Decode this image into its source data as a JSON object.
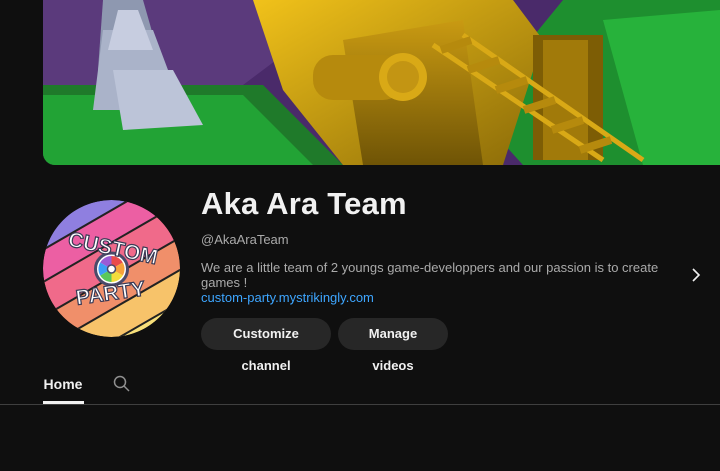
{
  "channel": {
    "name": "Aka Ara Team",
    "handle": "@AkaAraTeam",
    "description": "We are a little team of 2 youngs game-developpers and our passion is to create games !",
    "link": "custom-party.mystrikingly.com",
    "avatar_text_top": "CUSTOM",
    "avatar_text_bottom": "PARTY"
  },
  "actions": {
    "customize_label": "Customize channel",
    "manage_label": "Manage videos"
  },
  "tabs": [
    {
      "label": "Home",
      "selected": true
    }
  ],
  "icons": {
    "description_more": "chevron-right-icon",
    "search_tab": "search-icon"
  },
  "colors": {
    "background": "#0f0f0f",
    "link": "#3ea6ff",
    "button_bg": "#272727",
    "secondary_text": "#aaaaaa"
  }
}
